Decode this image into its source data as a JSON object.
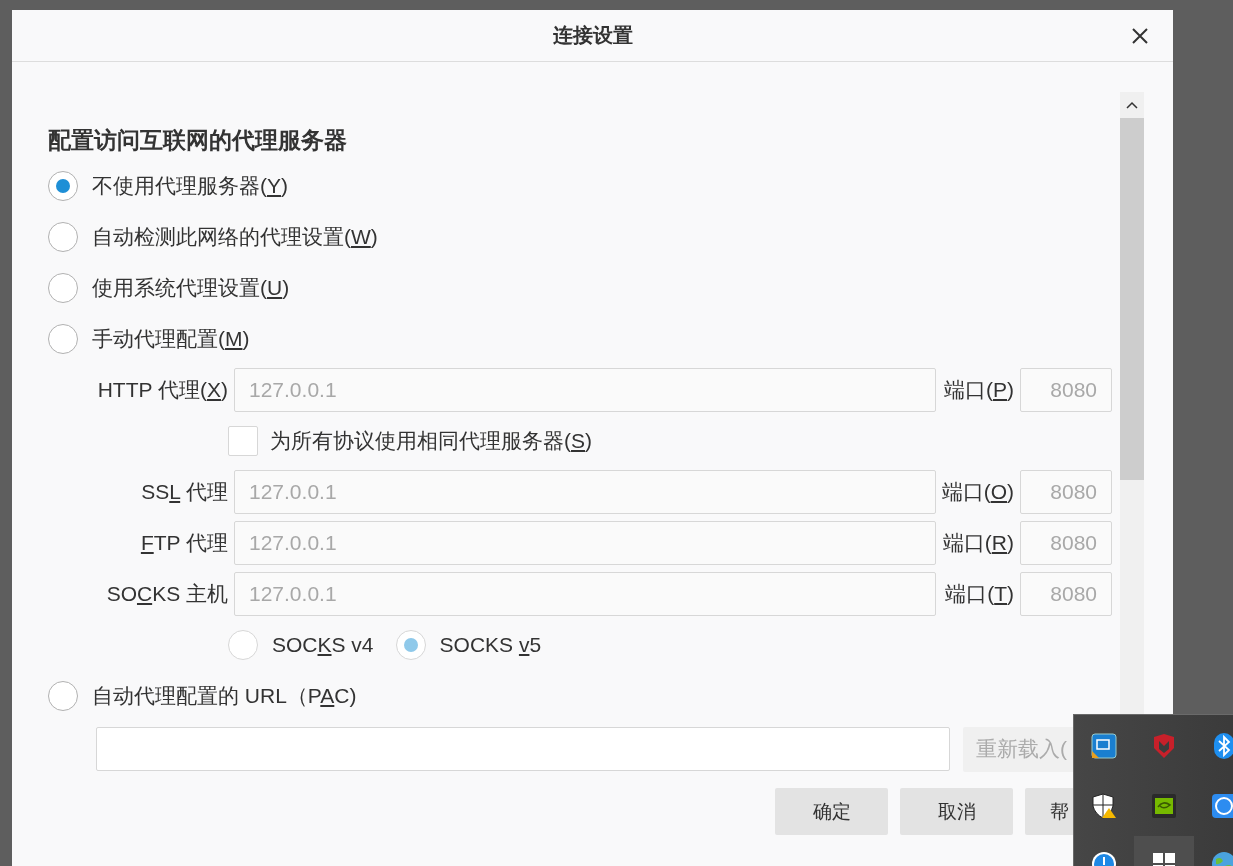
{
  "dialog": {
    "title": "连接设置"
  },
  "heading": "配置访问互联网的代理服务器",
  "modes": [
    {
      "label": {
        "pre": "不使用代理服务器(",
        "key": "Y",
        "post": ")"
      },
      "selected": true
    },
    {
      "label": {
        "pre": "自动检测此网络的代理设置(",
        "key": "W",
        "post": ")"
      },
      "selected": false
    },
    {
      "label": {
        "pre": "使用系统代理设置(",
        "key": "U",
        "post": ")"
      },
      "selected": false
    },
    {
      "label": {
        "pre": "手动代理配置(",
        "key": "M",
        "post": ")"
      },
      "selected": false
    }
  ],
  "manual": {
    "disabled": true,
    "proxies": [
      {
        "kind": "field",
        "label": {
          "pre": "HTTP 代理(",
          "key": "X",
          "post": ")"
        },
        "value": "127.0.0.1",
        "port_label": {
          "pre": "端口(",
          "key": "P",
          "post": ")"
        },
        "port": "8080"
      },
      {
        "kind": "checkbox",
        "label": {
          "pre": "为所有协议使用相同代理服务器(",
          "key": "S",
          "post": ")"
        },
        "checked": false
      },
      {
        "kind": "field",
        "label": {
          "pre": "SS",
          "key": "L",
          "post": " 代理"
        },
        "value": "127.0.0.1",
        "port_label": {
          "pre": "端口(",
          "key": "O",
          "post": ")"
        },
        "port": "8080"
      },
      {
        "kind": "field",
        "label": {
          "key": "F",
          "post": "TP 代理"
        },
        "value": "127.0.0.1",
        "port_label": {
          "pre": "端口(",
          "key": "R",
          "post": ")"
        },
        "port": "8080"
      },
      {
        "kind": "field",
        "label": {
          "pre": "SO",
          "key": "C",
          "post": "KS 主机"
        },
        "value": "127.0.0.1",
        "port_label": {
          "pre": "端口(",
          "key": "T",
          "post": ")"
        },
        "port": "8080"
      }
    ],
    "socks_versions": [
      {
        "label": {
          "pre": "SOC",
          "key": "K",
          "post": "S v4"
        },
        "selected": false
      },
      {
        "label": {
          "pre": "SOCKS ",
          "key": "v",
          "post": "5"
        },
        "selected": true
      }
    ]
  },
  "pac": {
    "label": {
      "pre": "自动代理配置的 URL（P",
      "key": "A",
      "post": "C)"
    },
    "selected": false,
    "reload_button": {
      "label": "重新载入(",
      "disabled": true
    }
  },
  "buttons": [
    {
      "label": "确定",
      "cut": false
    },
    {
      "label": "取消",
      "cut": false
    },
    {
      "label": "帮",
      "cut": true
    }
  ]
}
